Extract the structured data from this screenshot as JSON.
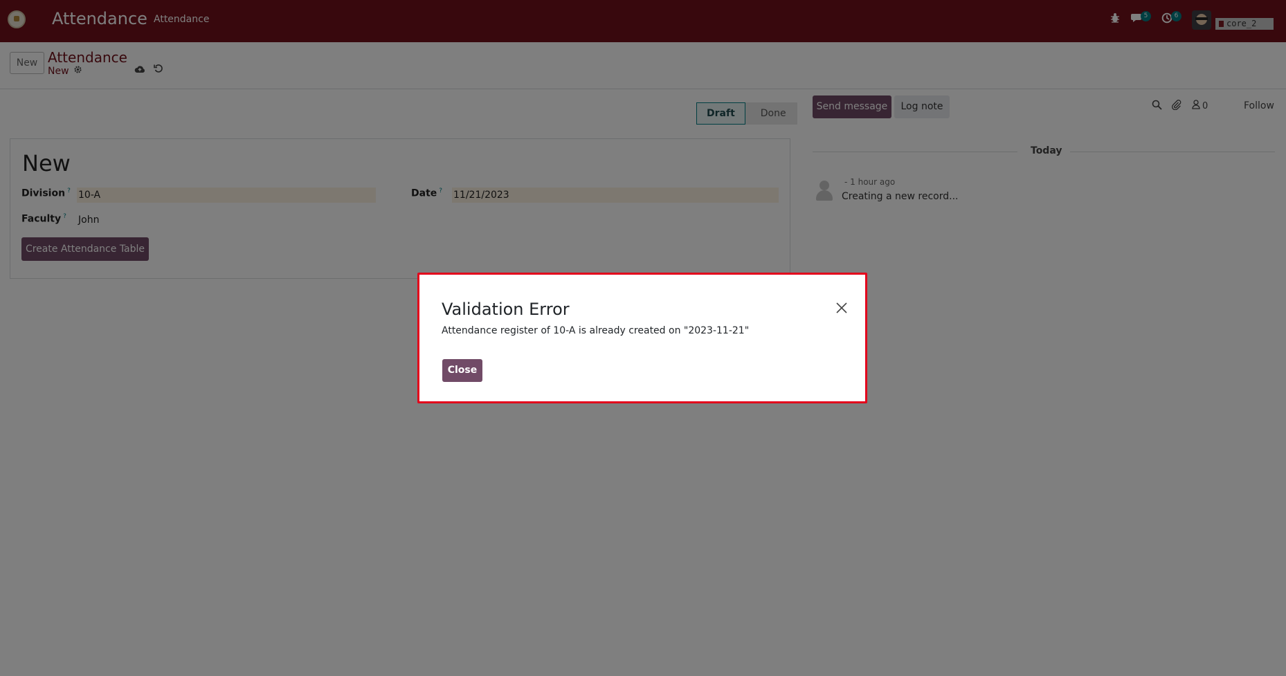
{
  "navbar": {
    "brand": "Attendance",
    "menu": "Attendance",
    "chat_badge": "5",
    "activity_badge": "6",
    "db_name": "core_2",
    "icons": [
      "bug-icon",
      "chat-icon",
      "clock-icon"
    ]
  },
  "control_panel": {
    "new_label": "New",
    "breadcrumb_title": "Attendance",
    "breadcrumb_sub": "New"
  },
  "statusbar": {
    "draft": "Draft",
    "done": "Done"
  },
  "form": {
    "title": "New",
    "division_label": "Division",
    "division_value": "10-A",
    "date_label": "Date",
    "date_value": "11/21/2023",
    "faculty_label": "Faculty",
    "faculty_value": "John",
    "help_mark": "?",
    "create_button": "Create Attendance Table"
  },
  "chatter": {
    "send_message": "Send message",
    "log_note": "Log note",
    "followers_count": "0",
    "follow": "Follow",
    "today": "Today",
    "message_time": "- 1 hour ago",
    "message_body": "Creating a new record..."
  },
  "dialog": {
    "title": "Validation Error",
    "body": "Attendance register of 10-A is already created on \"2023-11-21\"",
    "close_button": "Close"
  },
  "colors": {
    "navbar": "#71111a",
    "primary": "#714b67",
    "accent": "#017e84",
    "dialog_border": "#e3001b"
  }
}
